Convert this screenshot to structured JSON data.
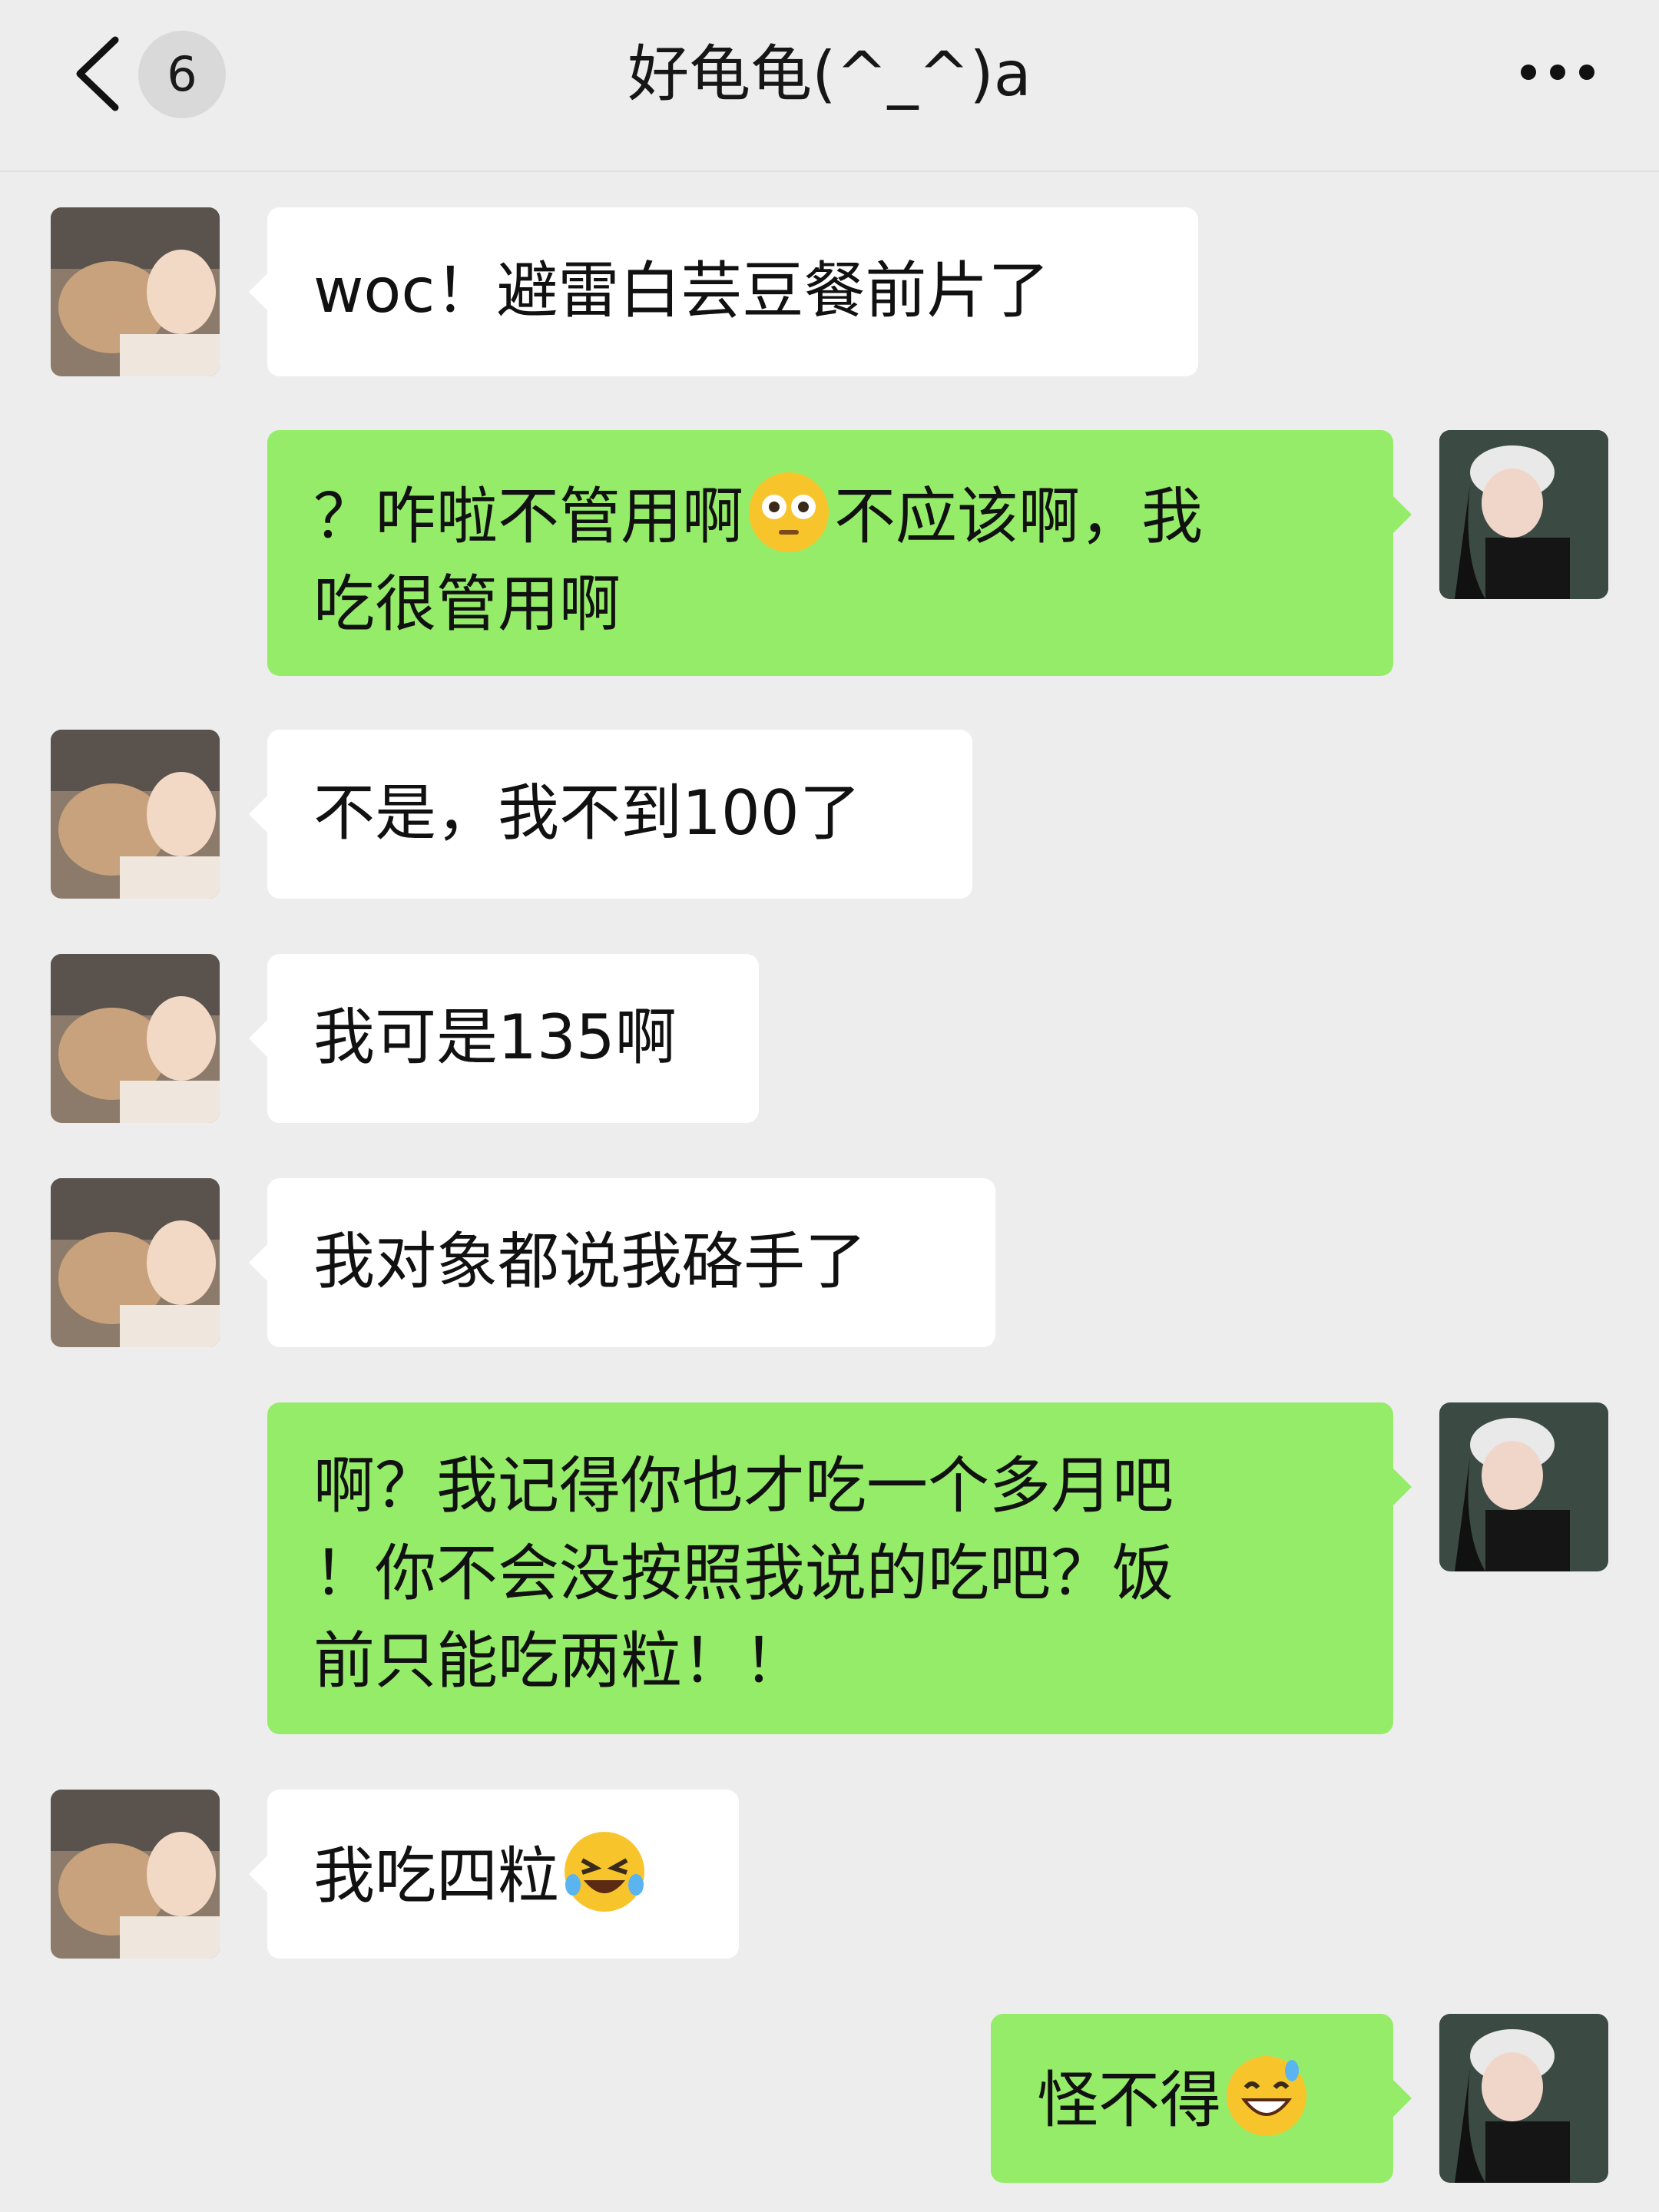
{
  "header": {
    "back_icon": "chevron-left-icon",
    "unread_count": "6",
    "title": "好龟龟(^_^)a",
    "more_icon": "more-dots-icon"
  },
  "messages": [
    {
      "side": "left",
      "text": "woc！避雷白芸豆餐前片了"
    },
    {
      "side": "right",
      "text_before": "？咋啦不管用啊",
      "emoji": "flushed-face-emoji",
      "text_after": "不应该啊，我\n吃很管用啊"
    },
    {
      "side": "left",
      "text": "不是，我不到100了"
    },
    {
      "side": "left",
      "text": "我可是135啊"
    },
    {
      "side": "left",
      "text": "我对象都说我硌手了"
    },
    {
      "side": "right",
      "text": "啊？我记得你也才吃一个多月吧\n！你不会没按照我说的吃吧？饭\n前只能吃两粒！！"
    },
    {
      "side": "left",
      "text_before": "我吃四粒",
      "emoji": "rolling-laughing-emoji"
    },
    {
      "side": "right",
      "text_before": "怪不得",
      "emoji": "grinning-sweat-emoji"
    }
  ],
  "colors": {
    "background": "#ededed",
    "incoming_bubble": "#ffffff",
    "outgoing_bubble": "#95ec69"
  }
}
